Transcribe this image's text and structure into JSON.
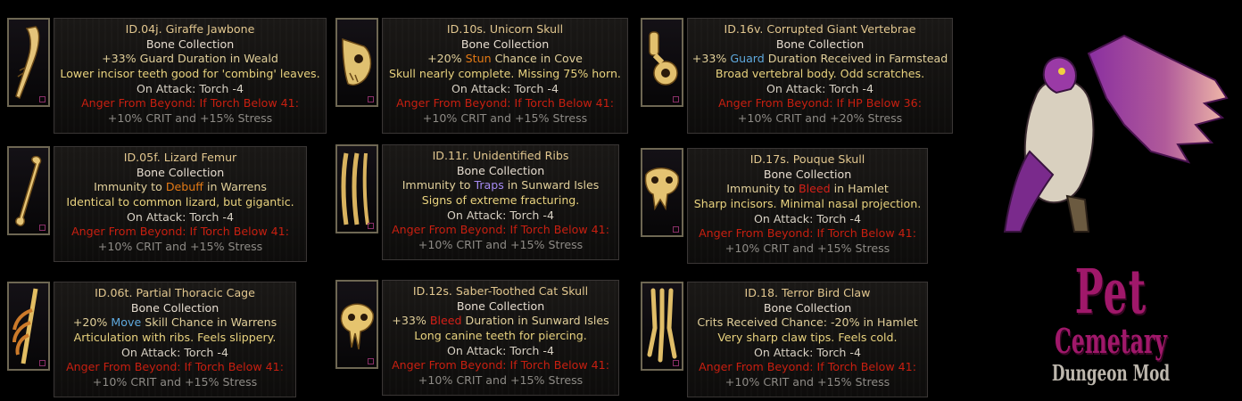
{
  "items": [
    {
      "title": "ID.04j. Giraffe Jawbone",
      "collection": "Bone Collection",
      "stat": [
        {
          "t": "+33% Guard Duration in Weald",
          "c": ""
        }
      ],
      "desc": "Lower incisor teeth good for 'combing' leaves.",
      "attack": "On Attack: Torch -4",
      "anger": "Anger From Beyond: If Torch Below 41:",
      "crit": "+10% CRIT and +15% Stress",
      "icon": "jawbone-icon"
    },
    {
      "title": "ID.10s. Unicorn Skull",
      "collection": "Bone Collection",
      "stat": [
        {
          "t": "+20% ",
          "c": ""
        },
        {
          "t": "Stun",
          "c": "orange"
        },
        {
          "t": " Chance in Cove",
          "c": ""
        }
      ],
      "desc": "Skull nearly complete. Missing 75% horn.",
      "attack": "On Attack: Torch -4",
      "anger": "Anger From Beyond: If Torch Below 41:",
      "crit": "+10% CRIT and +15% Stress",
      "icon": "unicorn-skull-icon"
    },
    {
      "title": "ID.16v. Corrupted Giant Vertebrae",
      "collection": "Bone Collection",
      "stat": [
        {
          "t": "+33% ",
          "c": ""
        },
        {
          "t": "Guard",
          "c": "blue"
        },
        {
          "t": " Duration Received in Farmstead",
          "c": ""
        }
      ],
      "desc": "Broad vertebral body. Odd scratches.",
      "attack": "On Attack: Torch -4",
      "anger": "Anger From Beyond: If HP Below 36:",
      "crit": "+10% CRIT and +20% Stress",
      "icon": "vertebrae-icon"
    },
    {
      "title": "ID.05f. Lizard Femur",
      "collection": "Bone Collection",
      "stat": [
        {
          "t": "Immunity to ",
          "c": ""
        },
        {
          "t": "Debuff",
          "c": "orange"
        },
        {
          "t": " in Warrens",
          "c": ""
        }
      ],
      "desc": "Identical to common lizard, but gigantic.",
      "attack": "On Attack: Torch -4",
      "anger": "Anger From Beyond: If Torch Below 41:",
      "crit": "+10% CRIT and +15% Stress",
      "icon": "femur-icon"
    },
    {
      "title": "ID.11r. Unidentified Ribs",
      "collection": "Bone Collection",
      "stat": [
        {
          "t": "Immunity to ",
          "c": ""
        },
        {
          "t": "Traps",
          "c": "purple"
        },
        {
          "t": " in Sunward Isles",
          "c": ""
        }
      ],
      "desc": "Signs of extreme fracturing.",
      "attack": "On Attack: Torch -4",
      "anger": "Anger From Beyond: If Torch Below 41:",
      "crit": "+10% CRIT and +15% Stress",
      "icon": "ribs-icon"
    },
    {
      "title": "ID.17s. Pouque Skull",
      "collection": "Bone Collection",
      "stat": [
        {
          "t": "Immunity to ",
          "c": ""
        },
        {
          "t": "Bleed",
          "c": "red"
        },
        {
          "t": " in Hamlet",
          "c": ""
        }
      ],
      "desc": "Sharp incisors. Minimal nasal projection.",
      "attack": "On Attack: Torch -4",
      "anger": "Anger From Beyond: If Torch Below 41:",
      "crit": "+10% CRIT and +15% Stress",
      "icon": "pouque-skull-icon"
    },
    {
      "title": "ID.06t. Partial Thoracic Cage",
      "collection": "Bone Collection",
      "stat": [
        {
          "t": "+20% ",
          "c": ""
        },
        {
          "t": "Move",
          "c": "blue"
        },
        {
          "t": " Skill Chance in Warrens",
          "c": ""
        }
      ],
      "desc": "Articulation with ribs. Feels slippery.",
      "attack": "On Attack: Torch -4",
      "anger": "Anger From Beyond: If Torch Below 41:",
      "crit": "+10% CRIT and +15% Stress",
      "icon": "thoracic-cage-icon"
    },
    {
      "title": "ID.12s. Saber-Toothed Cat Skull",
      "collection": "Bone Collection",
      "stat": [
        {
          "t": "+33% ",
          "c": ""
        },
        {
          "t": "Bleed",
          "c": "red"
        },
        {
          "t": " Duration in Sunward Isles",
          "c": ""
        }
      ],
      "desc": "Long canine teeth for piercing.",
      "attack": "On Attack: Torch -4",
      "anger": "Anger From Beyond: If Torch Below 41:",
      "crit": "+10% CRIT and +15% Stress",
      "icon": "saber-skull-icon"
    },
    {
      "title": "ID.18. Terror Bird Claw",
      "collection": "Bone Collection",
      "stat": [
        {
          "t": "Crits Received Chance: -20% in Hamlet",
          "c": ""
        }
      ],
      "desc": "Very sharp claw tips. Feels cold.",
      "attack": "On Attack: Torch -4",
      "anger": "Anger From Beyond: If Torch Below 41:",
      "crit": "+10% CRIT and +15% Stress",
      "icon": "claw-icon"
    }
  ],
  "logo": {
    "line1": "Pet",
    "line2": "Cemetary",
    "line3": "Dungeon Mod",
    "icon": "griffin-icon"
  },
  "colors": {
    "title": "#e2c78f",
    "desc": "#e8d27e",
    "anger": "#c81f10",
    "crit": "#8e8b86",
    "blue": "#5fa9de",
    "orange": "#e57a15",
    "purple": "#a68bf2",
    "red": "#d42018",
    "frame": "#6e6753",
    "brand": "#a0186a"
  }
}
